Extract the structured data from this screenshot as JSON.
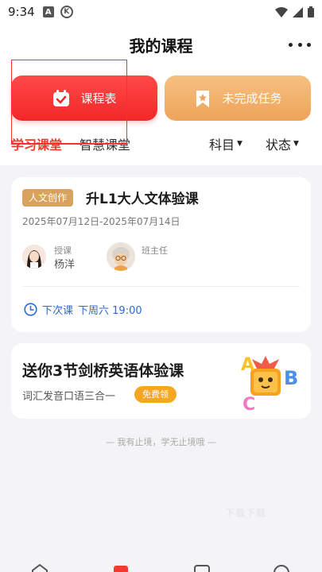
{
  "status_bar": {
    "time": "9:34",
    "icons": [
      "a-notification-icon",
      "k-notification-icon",
      "wifi-icon",
      "signal-icon",
      "battery-icon"
    ]
  },
  "header": {
    "title": "我的课程",
    "more_icon": "more-dots-icon"
  },
  "actions": {
    "schedule_label": "课程表",
    "tasks_label": "未完成任务"
  },
  "tabs": {
    "items": [
      "学习课堂",
      "智慧课堂"
    ],
    "active_index": 0,
    "filters": [
      "科目",
      "状态"
    ]
  },
  "course_card": {
    "tag": "人文创作",
    "title": "升L1大人文体验课",
    "dates": "2025年07月12日-2025年07月14日",
    "teacher_role": "授课",
    "teacher_name": "杨洋",
    "head_teacher_role": "班主任",
    "next_class_label": "下次课",
    "next_class_time": "下周六 19:00"
  },
  "promo_card": {
    "title": "送你3节剑桥英语体验课",
    "subtitle": "词汇发音口语三合一",
    "badge": "免费领"
  },
  "slogan": "— 我有止境，学无止境哦 —",
  "watermark": "下载下载",
  "colors": {
    "accent_red": "#f23a2e",
    "schedule_button": "#f22727",
    "tasks_button": "#eea35a",
    "tag_gold": "#d9a35f",
    "link_blue": "#2a6ad1",
    "badge_orange": "#f6a623"
  }
}
